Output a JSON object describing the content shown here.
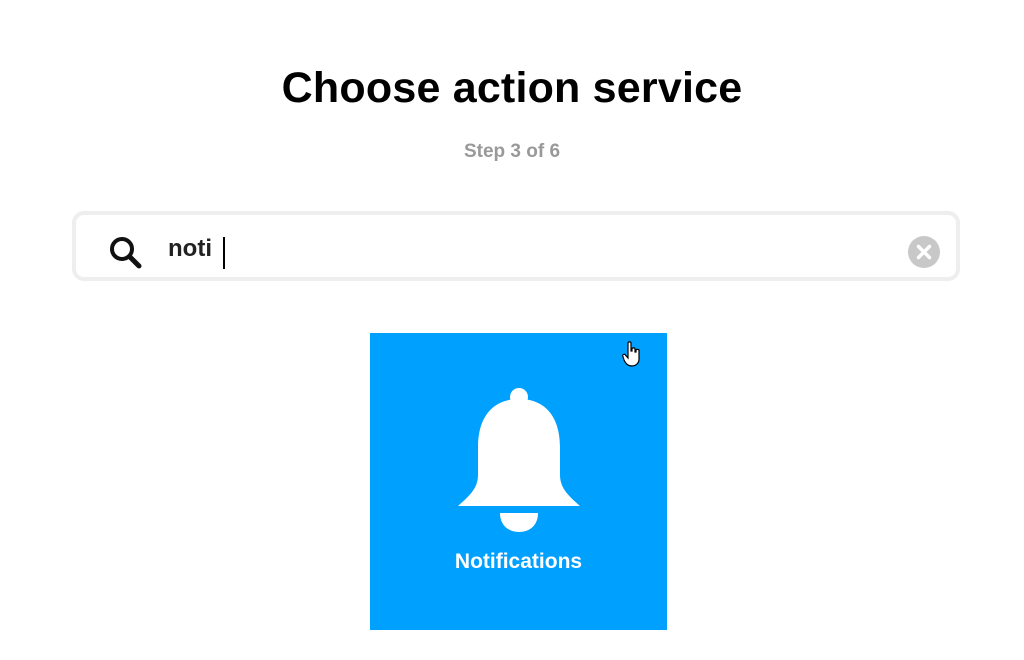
{
  "header": {
    "title": "Choose action service",
    "step": "Step 3 of 6"
  },
  "search": {
    "value": "noti",
    "icon": "search-icon",
    "clear_icon": "clear-icon"
  },
  "results": [
    {
      "label": "Notifications",
      "icon": "bell-icon",
      "color": "#00a0ff"
    }
  ],
  "colors": {
    "accent": "#00a0ff",
    "muted_text": "#999999"
  }
}
